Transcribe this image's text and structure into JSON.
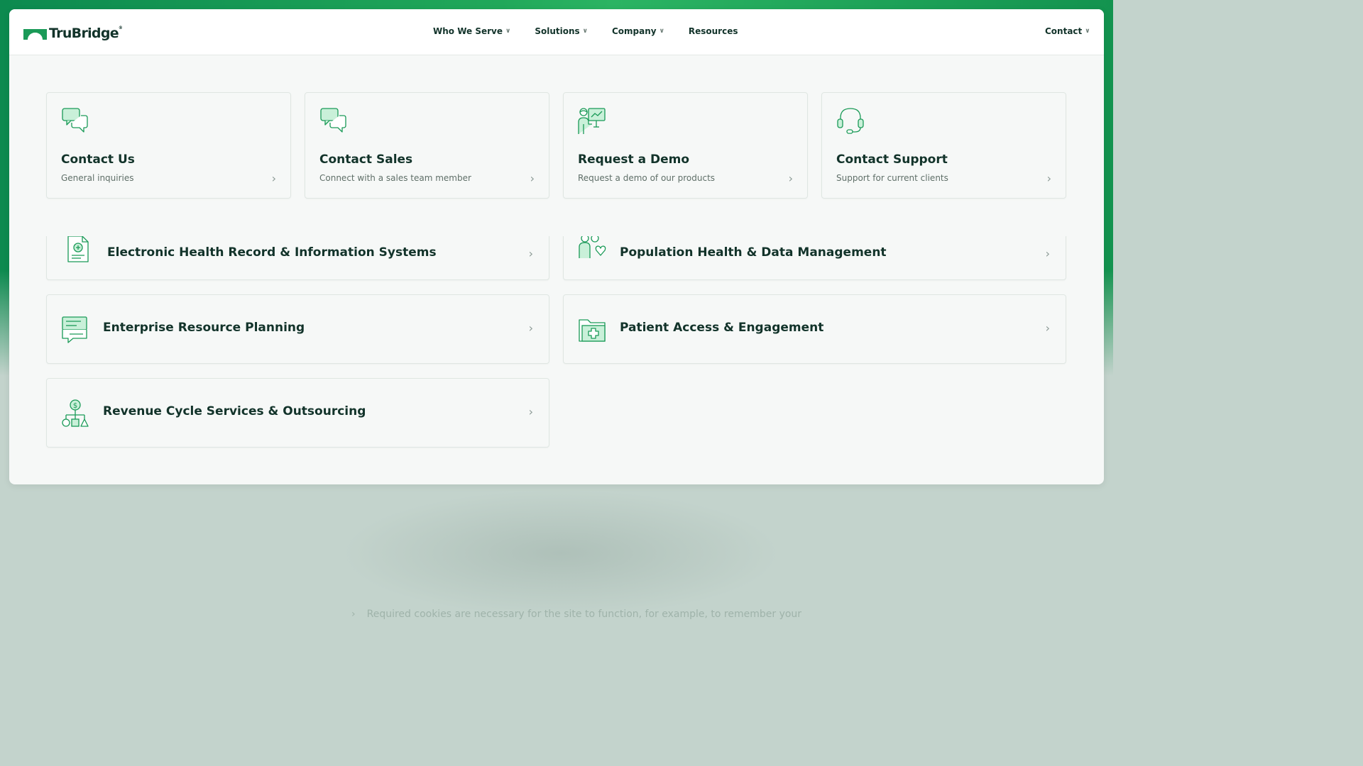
{
  "brand": {
    "name": "TruBridge",
    "mark": "®"
  },
  "nav": {
    "items": [
      {
        "label": "Who We Serve",
        "caret": "∨"
      },
      {
        "label": "Solutions",
        "caret": "∨"
      },
      {
        "label": "Company",
        "caret": "∨"
      },
      {
        "label": "Resources"
      }
    ],
    "contact": {
      "label": "Contact",
      "caret": "∨"
    }
  },
  "contact_cards": [
    {
      "title": "Contact Us",
      "subtitle": "General inquiries",
      "icon": "chat-bubbles-icon"
    },
    {
      "title": "Contact Sales",
      "subtitle": "Connect with a sales team member",
      "icon": "chat-bubbles-icon"
    },
    {
      "title": "Request a Demo",
      "subtitle": "Request a demo of our products",
      "icon": "presenter-icon"
    },
    {
      "title": "Contact Support",
      "subtitle": "Support for current clients",
      "icon": "headset-icon"
    }
  ],
  "solutions": [
    {
      "title": "Electronic Health Record & Information Systems",
      "icon": "medical-document-icon"
    },
    {
      "title": "Population Health & Data Management",
      "icon": "people-heart-icon"
    },
    {
      "title": "Enterprise Resource Planning",
      "icon": "chat-screens-icon"
    },
    {
      "title": "Patient Access & Engagement",
      "icon": "medical-folder-icon"
    },
    {
      "title": "Revenue Cycle Services & Outsourcing",
      "icon": "dollar-hierarchy-icon"
    }
  ],
  "chevron": "›",
  "cookie_text": "Required cookies are necessary for the site to function, for example, to remember your",
  "colors": {
    "accent": "#1a9a57",
    "icon_fill": "#c9f0d9",
    "title": "#12332a",
    "background_green": "#21a85a"
  }
}
